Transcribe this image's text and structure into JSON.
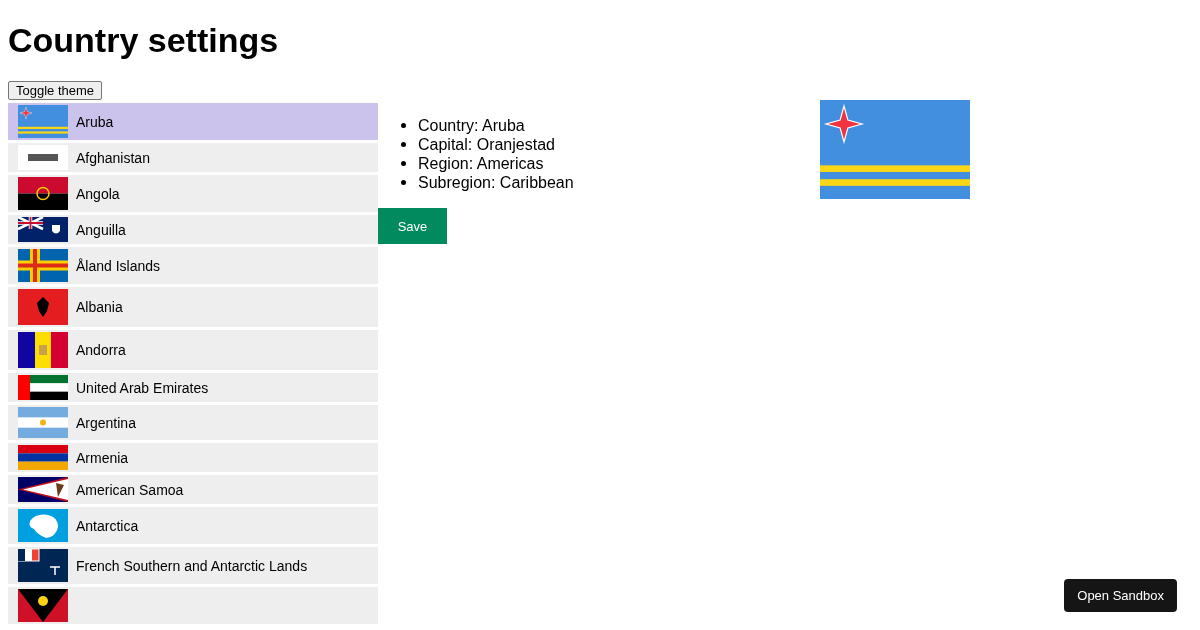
{
  "title": "Country settings",
  "toggle_button": "Toggle theme",
  "countries": [
    {
      "name": "Aruba",
      "kind": "aruba",
      "selected": true
    },
    {
      "name": "Afghanistan",
      "kind": "afghanistan",
      "selected": false
    },
    {
      "name": "Angola",
      "kind": "angola",
      "selected": false
    },
    {
      "name": "Anguilla",
      "kind": "anguilla",
      "selected": false
    },
    {
      "name": "Åland Islands",
      "kind": "aland",
      "selected": false
    },
    {
      "name": "Albania",
      "kind": "albania",
      "selected": false
    },
    {
      "name": "Andorra",
      "kind": "andorra",
      "selected": false
    },
    {
      "name": "United Arab Emirates",
      "kind": "uae",
      "selected": false
    },
    {
      "name": "Argentina",
      "kind": "argentina",
      "selected": false
    },
    {
      "name": "Armenia",
      "kind": "armenia",
      "selected": false
    },
    {
      "name": "American Samoa",
      "kind": "samoa",
      "selected": false
    },
    {
      "name": "Antarctica",
      "kind": "antarctica",
      "selected": false
    },
    {
      "name": "French Southern and Antarctic Lands",
      "kind": "fsal",
      "selected": false
    },
    {
      "kind": "antigua",
      "selected": false
    }
  ],
  "details": [
    "Country: Aruba",
    "Capital: Oranjestad",
    "Region: Americas",
    "Subregion: Caribbean"
  ],
  "save_button": "Save",
  "detail_flag": {
    "kind": "aruba"
  },
  "sandbox_button": "Open Sandbox"
}
